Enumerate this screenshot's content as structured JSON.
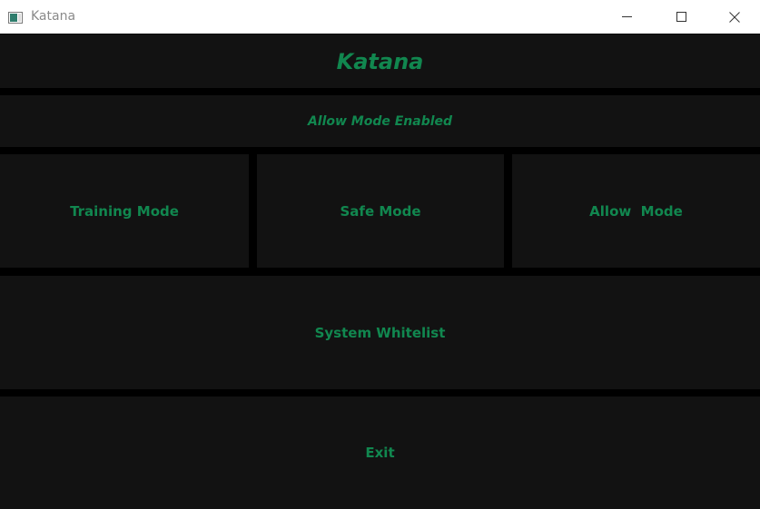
{
  "window": {
    "title": "Katana",
    "icon": "app-window-icon",
    "controls": [
      "minimize-icon",
      "maximize-icon",
      "close-icon"
    ]
  },
  "header": {
    "title": "Katana"
  },
  "status": {
    "text": "Allow Mode Enabled"
  },
  "modes": {
    "training_label": "Training Mode",
    "safe_label": "Safe Mode",
    "allow_label": "Allow  Mode"
  },
  "whitelist": {
    "label": "System Whitelist"
  },
  "exit": {
    "label": "Exit"
  },
  "colors": {
    "accent": "#11874f",
    "panel_bg": "#121212",
    "gutter": "#000000",
    "titlebar_bg": "#ffffff"
  }
}
